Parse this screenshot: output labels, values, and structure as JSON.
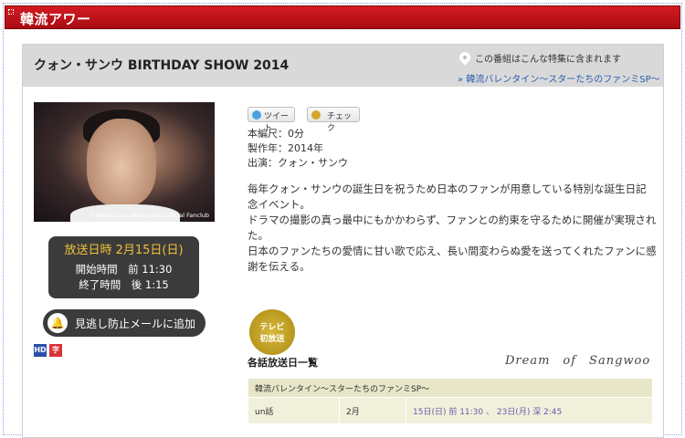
{
  "header": {
    "title": "韓流アワー"
  },
  "program": {
    "title": "クォン・サンウ BIRTHDAY SHOW 2014"
  },
  "special": {
    "note": "この番組はこんな特集に含まれます",
    "link": "» 韓流バレンタイン〜スターたちのファンミSP〜"
  },
  "photo": {
    "caption": "©Kwon Sang Woo Japan Official Fanclub"
  },
  "airing": {
    "date_label": "放送日時 2月15日(日)",
    "start": "開始時間　前 11:30",
    "end": "終了時間　後 1:15"
  },
  "reminder": {
    "label": "見逃し防止メールに追加"
  },
  "badges": {
    "hd": "HD",
    "subtitle": "字"
  },
  "social": {
    "tweet": "ツイート",
    "check": "チェック"
  },
  "meta": {
    "duration": "本編尺：0分",
    "year": "製作年：2014年",
    "cast": "出演：クォン・サンウ"
  },
  "description": [
    "毎年クォン・サンウの誕生日を祝うため日本のファンが用意している特別な誕生日記念イベント。",
    "ドラマの撮影の真っ最中にもかかわらず、ファンとの約束を守るために開催が実現された。",
    "日本のファンたちの愛情に甘い歌で応え、長い間変わらぬ愛を送ってくれたファンに感謝を伝える。"
  ],
  "tv_badge": {
    "line1": "テレビ",
    "line2": "初放送"
  },
  "episodes": {
    "title": "各話放送日一覧",
    "signature": "Dream　of　Sangwoo",
    "table_header": "韓流バレンタイン〜スターたちのファンミSP〜",
    "rows": [
      {
        "episode": "un話",
        "month": "2月",
        "dates": "15日(日) 前 11:30 、 23日(月) 深 2:45"
      }
    ]
  },
  "colors": {
    "header_red": "#c8141c",
    "air_date_gold": "#f0c23a",
    "link_blue": "#2a5db0"
  }
}
